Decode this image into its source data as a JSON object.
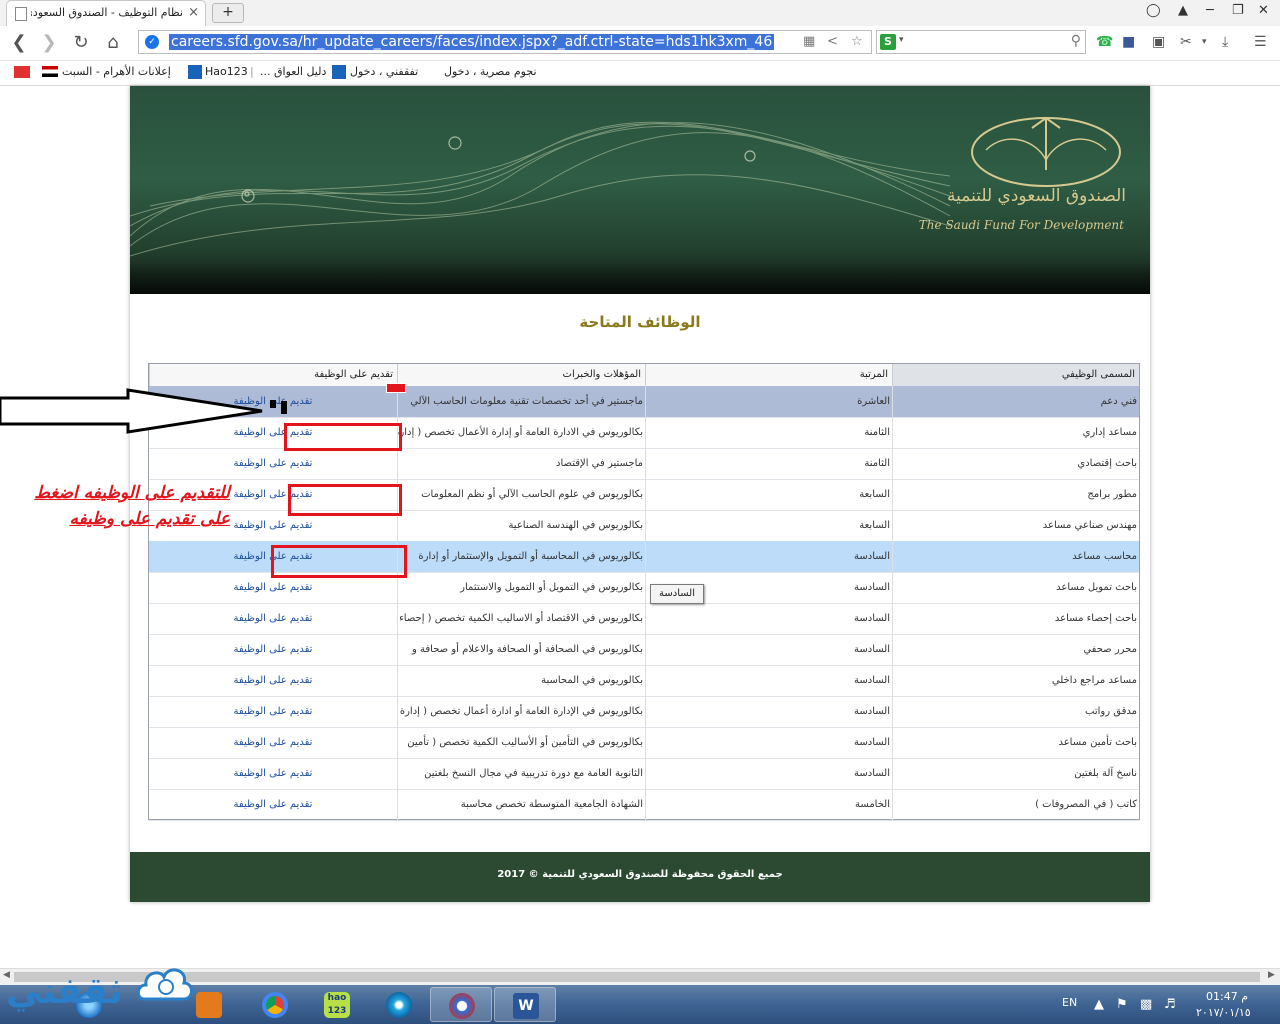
{
  "browser": {
    "tab_title": "نظام التوظيف - الصندوق السعودي",
    "tab_close": "×",
    "new_tab": "+",
    "url": "careers.sfd.gov.sa/hr_update_careers/faces/index.jspx?_adf.ctrl-state=hds1hk3xm_46",
    "search_logo": "S",
    "bookmarks": [
      "إعلانات الأهرام - السبت",
      "Hao123",
      "دليل العواق ...",
      "تفقفني ، دخول",
      "نجوم مصرية ، دخول"
    ]
  },
  "banner": {
    "arabic_name": "الصندوق السعودي للتنمية",
    "english_name": "The Saudi Fund For Development"
  },
  "page": {
    "heading": "الوظائف المتاحة"
  },
  "grid": {
    "headers": {
      "job_title": "المسمى الوظيفي",
      "grade": "المرتبة",
      "qualifications": "المؤهلات والخبرات",
      "apply": "تقديم على الوظيفة"
    },
    "rows": [
      {
        "job_title": "فني دعم",
        "grade": "العاشرة",
        "qualifications": "ماجستير في أحد تخصصات تقنية معلومات الحاسب الآلي",
        "apply": "تقديم على الوظيفة"
      },
      {
        "job_title": "مساعد إداري",
        "grade": "الثامنة",
        "qualifications": "بكالوريوس في الادارة العامة أو إدارة الأعمال تخصص ( إدارة",
        "apply": "تقديم على الوظيفة"
      },
      {
        "job_title": "باحث إقتصادي",
        "grade": "الثامنة",
        "qualifications": "ماجستير في الإقتصاد",
        "apply": "تقديم على الوظيفة"
      },
      {
        "job_title": "مطور برامج",
        "grade": "السابعة",
        "qualifications": "بكالوريوس في علوم الحاسب الآلي أو نظم المعلومات",
        "apply": "تقديم على الوظيفة"
      },
      {
        "job_title": "مهندس صناعي مساعد",
        "grade": "السابعة",
        "qualifications": "بكالوريوس في الهندسة الصناعية",
        "apply": "تقديم على الوظيفة"
      },
      {
        "job_title": "محاسب مساعد",
        "grade": "السادسة",
        "qualifications": "بكالوريوس في المحاسبة أو التمويل والإستثمار أو إدارة",
        "apply": "تقديم على الوظيفة"
      },
      {
        "job_title": "باحث تمويل مساعد",
        "grade": "السادسة",
        "qualifications": "بكالوريوس في التمويل أو التمويل والاستثمار",
        "apply": "تقديم على الوظيفة"
      },
      {
        "job_title": "باحث إحصاء مساعد",
        "grade": "السادسة",
        "qualifications": "بكالوريوس في الاقتصاد أو الاساليب الكمية تخصص ( إحصاء",
        "apply": "تقديم على الوظيفة"
      },
      {
        "job_title": "محرر صحفي",
        "grade": "السادسة",
        "qualifications": "بكالوريوس في الصحافة أو الصحافة والاعلام أو صحافة و",
        "apply": "تقديم على الوظيفة"
      },
      {
        "job_title": "مساعد مراجع داخلي",
        "grade": "السادسة",
        "qualifications": "بكالوريوس في المحاسبة",
        "apply": "تقديم على الوظيفة"
      },
      {
        "job_title": "مدقق رواتب",
        "grade": "السادسة",
        "qualifications": "بكالوريوس في الإدارة العامة أو ادارة أعمال تخصص ( إدارة",
        "apply": "تقديم على الوظيفة"
      },
      {
        "job_title": "باحث تأمين مساعد",
        "grade": "السادسة",
        "qualifications": "بكالوريوس في التأمين أو الأساليب الكمية تخصص ( تأمين",
        "apply": "تقديم على الوظيفة"
      },
      {
        "job_title": "ناسخ آلة بلغتين",
        "grade": "السادسة",
        "qualifications": "الثانوية العامة مع دورة تدريبية في مجال النسخ بلغتين",
        "apply": "تقديم على الوظيفة"
      },
      {
        "job_title": "كاتب ( في المصروفات )",
        "grade": "الخامسة",
        "qualifications": "الشهادة الجامعية المتوسطة تخصص محاسبة",
        "apply": "تقديم على الوظيفة"
      }
    ]
  },
  "tooltip": "السادسة",
  "annotation": {
    "line1": "للتقديم على الوظيفه اضغط",
    "line2": "على تقديم على وظيفه"
  },
  "footer": {
    "text": "جميع الحقوق محفوظة للصندوق السعودي للتنمية © 2017"
  },
  "taskbar": {
    "language": "EN",
    "time": "01:47 م",
    "date": "٢٠١٧/٠١/١٥",
    "hao_label": "hao 123"
  },
  "watermark": "ثقفني",
  "colors": {
    "selected_row_dark": "#aebbd6",
    "selected_row_light": "#bcdcf9",
    "apply_link": "#1f4f9d",
    "heading": "#8a7a1c",
    "annotation_red": "#e3141b",
    "footer_bg": "#2c4a32"
  }
}
